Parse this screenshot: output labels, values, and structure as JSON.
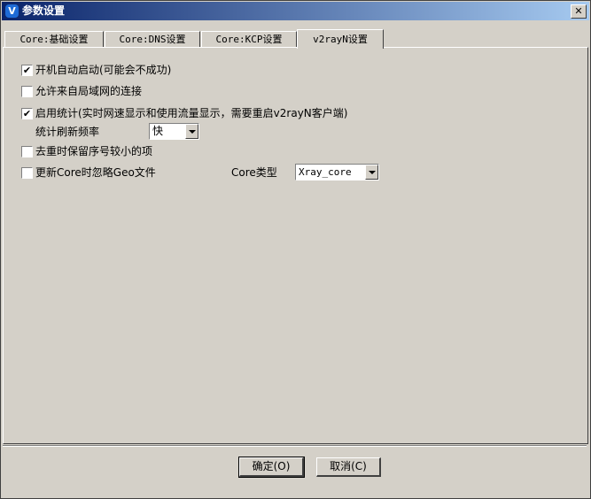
{
  "window": {
    "title": "参数设置",
    "app_icon_glyph": "V"
  },
  "tabs": [
    {
      "label": "Core:基础设置"
    },
    {
      "label": "Core:DNS设置"
    },
    {
      "label": "Core:KCP设置"
    },
    {
      "label": "v2rayN设置",
      "active": true
    }
  ],
  "options": {
    "auto_start": {
      "label": "开机自动启动(可能会不成功)",
      "checked": true
    },
    "allow_lan": {
      "label": "允许来自局域网的连接",
      "checked": false
    },
    "enable_stats": {
      "label": "启用统计(实时网速显示和使用流量显示，需要重启v2rayN客户端)",
      "checked": true
    },
    "stats_freq": {
      "label": "统计刷新频率",
      "value": "快"
    },
    "dedup_keep_small": {
      "label": "去重时保留序号较小的项",
      "checked": false
    },
    "ignore_geo": {
      "label": "更新Core时忽略Geo文件",
      "checked": false
    },
    "core_type": {
      "label": "Core类型",
      "value": "Xray_core"
    }
  },
  "buttons": {
    "ok": "确定(O)",
    "cancel": "取消(C)"
  },
  "glyphs": {
    "check": "✔",
    "close": "✕"
  }
}
